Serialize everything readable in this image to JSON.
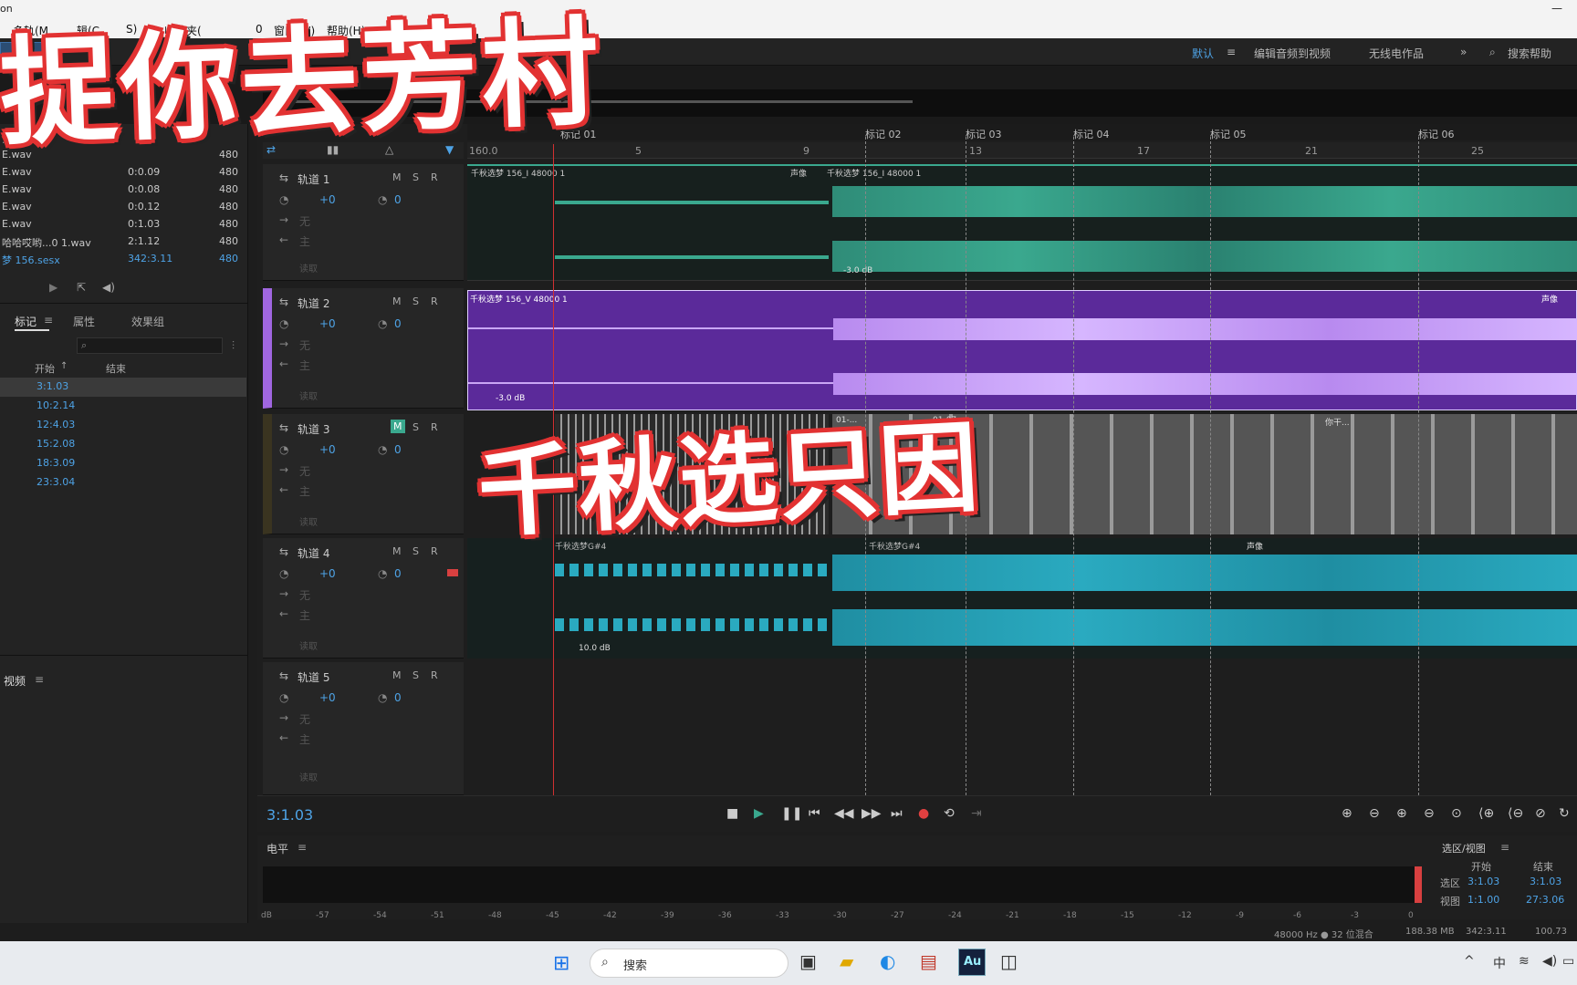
{
  "titlebar": {
    "text": "on",
    "minimize": "—"
  },
  "menu": [
    "多轨(M",
    "辑(C",
    "S)",
    "收藏夹(",
    "0",
    "窗口(W)",
    "帮助(H)"
  ],
  "toolbar": {
    "mode": "多轨",
    "workspaces": [
      "默认",
      "编辑音频到视频",
      "无线电作品"
    ],
    "more": "»",
    "search_label": "搜索帮助"
  },
  "editor_tab": {
    "label": "器: 千秋选梦",
    "extra": "器"
  },
  "files": [
    {
      "name": "E.wav",
      "dur": "",
      "rate": "480"
    },
    {
      "name": "E.wav",
      "dur": "0:0.09",
      "rate": "480"
    },
    {
      "name": "E.wav",
      "dur": "0:0.08",
      "rate": "480"
    },
    {
      "name": "E.wav",
      "dur": "0:0.12",
      "rate": "480"
    },
    {
      "name": "E.wav",
      "dur": "0:1.03",
      "rate": "480"
    },
    {
      "name": "哈哈哎哟...0 1.wav",
      "dur": "2:1.12",
      "rate": "480"
    },
    {
      "name": "梦 156.sesx",
      "dur": "342:3.11",
      "rate": "480"
    }
  ],
  "file_header": ".wav",
  "panel_tabs": [
    "标记",
    "属性",
    "效果组"
  ],
  "marker_cols": {
    "start": "开始",
    "end": "结束"
  },
  "marker_starts": [
    "3:1.03",
    "10:2.14",
    "12:4.03",
    "15:2.08",
    "18:3.09",
    "23:3.04"
  ],
  "video_panel": {
    "label": "视频"
  },
  "ruler": {
    "start": "160.0",
    "ticks": [
      "5",
      "9",
      "13",
      "17",
      "21",
      "25"
    ]
  },
  "markers": [
    "标记 01",
    "标记 02",
    "标记 03",
    "标记 04",
    "标记 05",
    "标记 06"
  ],
  "tracks": [
    {
      "name": "轨道 1",
      "vol": "+0",
      "pan": "0",
      "m": "M",
      "s": "S",
      "r": "R",
      "color": "#3aa88e",
      "clip1": "千秋选梦 156_I 48000 1",
      "clip2": "千秋选梦 156_I 48000 1",
      "label_right": "声像",
      "gain": "-3.0 dB",
      "input": "无",
      "output": "主",
      "read": "读取"
    },
    {
      "name": "轨道 2",
      "vol": "+0",
      "pan": "0",
      "m": "M",
      "s": "S",
      "r": "R",
      "color": "#a066e0",
      "clip1": "千秋选梦 156_V 48000 1",
      "clip2": "",
      "label_right": "声像",
      "gain": "-3.0 dB",
      "input": "无",
      "output": "主",
      "read": "读取"
    },
    {
      "name": "轨道 3",
      "vol": "+0",
      "pan": "0",
      "m": "M",
      "s": "S",
      "r": "R",
      "color": "#9a9a9a",
      "clip1": "01-...",
      "clip2": "01-07...",
      "label_right": "你干...",
      "gain": "",
      "input": "无",
      "output": "主",
      "read": "读取"
    },
    {
      "name": "轨道 4",
      "vol": "+0",
      "pan": "0",
      "m": "M",
      "s": "S",
      "r": "R",
      "color": "#2aaac0",
      "clip1": "千秋选梦G#4",
      "clip2": "千秋选梦G#4",
      "label_right": "声像",
      "gain": "10.0 dB",
      "input": "无",
      "output": "主",
      "read": "读取"
    },
    {
      "name": "轨道 5",
      "vol": "+0",
      "pan": "0",
      "m": "M",
      "s": "S",
      "r": "R",
      "color": "",
      "clip1": "",
      "clip2": "",
      "label_right": "",
      "gain": "",
      "input": "无",
      "output": "主",
      "read": "读取"
    }
  ],
  "transport": {
    "time": "3:1.03"
  },
  "levels": {
    "label": "电平",
    "scale": [
      "dB",
      "-57",
      "-54",
      "-51",
      "-48",
      "-45",
      "-42",
      "-39",
      "-36",
      "-33",
      "-30",
      "-27",
      "-24",
      "-21",
      "-18",
      "-15",
      "-12",
      "-9",
      "-6",
      "-3",
      "0"
    ]
  },
  "selview": {
    "title": "选区/视图",
    "col_start": "开始",
    "col_end": "结束",
    "sel_label": "选区",
    "sel_start": "3:1.03",
    "sel_end": "3:1.03",
    "view_label": "视图",
    "view_start": "1:1.00",
    "view_end": "27:3.06"
  },
  "status": {
    "format": "48000 Hz ● 32 位混合",
    "size": "188.38 MB",
    "dur": "342:3.11",
    "free": "100.73"
  },
  "overlays": {
    "top": "捉你去芳村",
    "mid": "千秋选只因"
  },
  "taskbar": {
    "search": "搜索",
    "ime": "中",
    "app_au": "Au"
  },
  "colors": {
    "accent": "#4ea3e6",
    "playhead": "#d03030",
    "overlay_stroke": "#e23232"
  }
}
